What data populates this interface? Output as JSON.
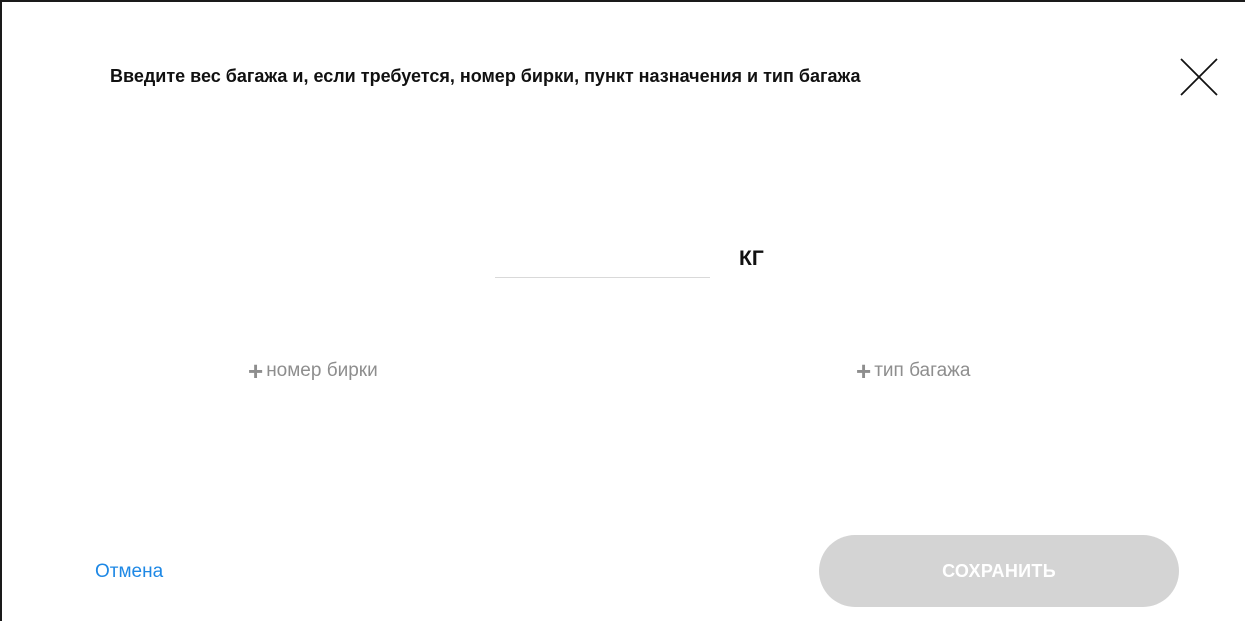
{
  "dialog": {
    "title": "Введите вес багажа и, если требуется, номер бирки, пункт назначения и тип багажа",
    "close_icon": "close-icon"
  },
  "weight": {
    "value": "",
    "placeholder": "",
    "unit": "КГ"
  },
  "options": {
    "tag_number": {
      "icon": "plus-icon",
      "label": "номер бирки"
    },
    "baggage_type": {
      "icon": "plus-icon",
      "label": "тип багажа"
    }
  },
  "footer": {
    "cancel_label": "Отмена",
    "save_label": "СОХРАНИТЬ",
    "save_enabled": false
  },
  "colors": {
    "link_blue": "#1e88e5",
    "muted_gray": "#8e8e8e",
    "disabled_button": "#d4d4d4"
  }
}
